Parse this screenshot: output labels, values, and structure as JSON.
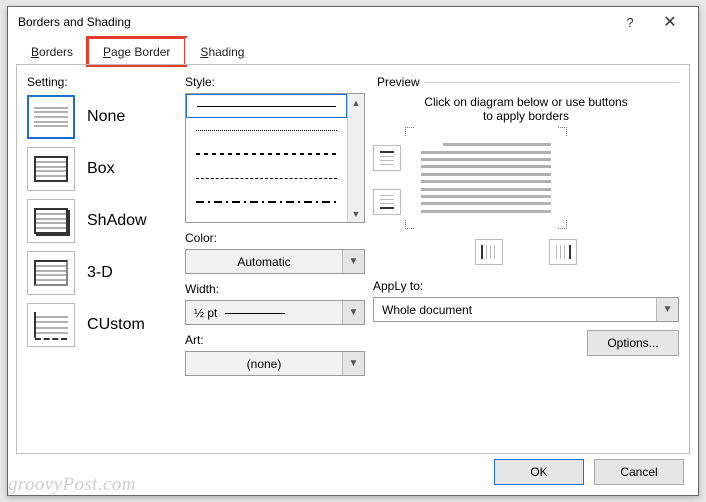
{
  "titlebar": {
    "title": "Borders and Shading",
    "help": "?",
    "close": "✕"
  },
  "tabs": {
    "borders": "Borders",
    "borders_u": "B",
    "pageborder": "Page Border",
    "pageborder_u": "P",
    "shading": "Shading",
    "shading_u": "S"
  },
  "settings": {
    "label": "Setting:",
    "none": "None",
    "none_u": "N",
    "box": "Box",
    "box_u": "x",
    "shadow": "Shadow",
    "shadow_u": "A",
    "threeD": "3-D",
    "threeD_u": "D",
    "custom": "Custom",
    "custom_u": "U"
  },
  "style": {
    "label": "Style:",
    "style_u": "y",
    "color_label": "Color:",
    "color_u": "C",
    "color_value": "Automatic",
    "width_label": "Width:",
    "width_u": "W",
    "width_value": "½ pt",
    "art_label": "Art:",
    "art_u": "r",
    "art_value": "(none)"
  },
  "preview": {
    "legend": "Preview",
    "hint1": "Click on diagram below or use buttons",
    "hint2": "to apply borders"
  },
  "applyto": {
    "label": "Apply to:",
    "label_u": "L",
    "value": "Whole document"
  },
  "options": {
    "label": "Options...",
    "label_u": "O"
  },
  "footer": {
    "ok": "OK",
    "cancel": "Cancel"
  },
  "watermark": "groovyPost.com"
}
